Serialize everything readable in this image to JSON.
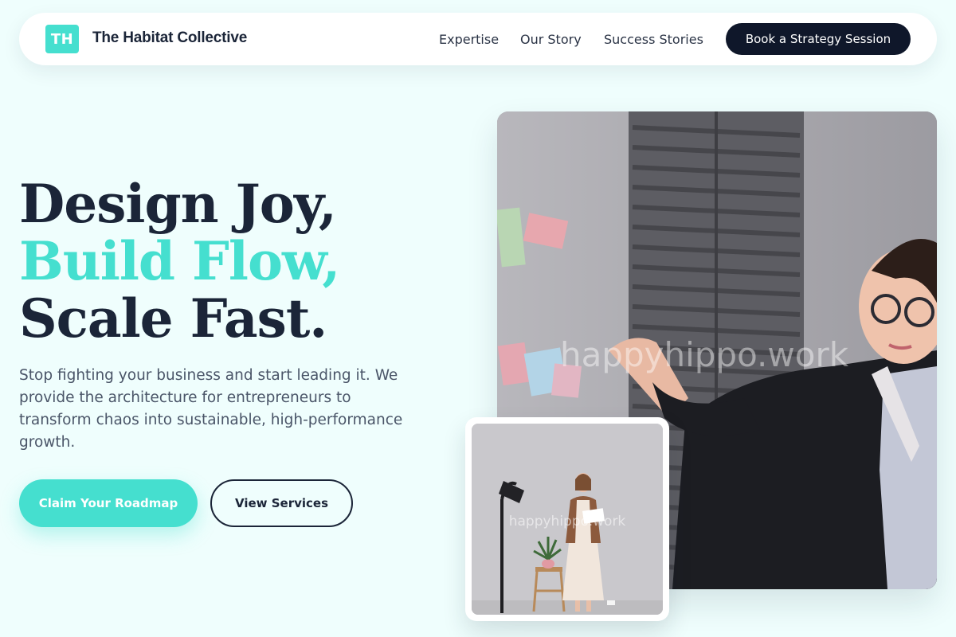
{
  "nav": {
    "logo_initials": "TH",
    "brand": "The Habitat Collective",
    "links": [
      "Expertise",
      "Our Story",
      "Success Stories"
    ],
    "cta": "Book a Strategy Session"
  },
  "hero": {
    "headline_line1": "Design Joy,",
    "headline_line2": "Build Flow,",
    "headline_line3": "Scale Fast.",
    "subtext": "Stop fighting your business and start leading it. We provide the architecture for entrepreneurs to transform chaos into sustainable, high-performance growth.",
    "primary_button": "Claim Your Roadmap",
    "secondary_button": "View Services"
  },
  "images": {
    "main_watermark": "happyhippo.work",
    "small_watermark": "happyhippo.work"
  },
  "colors": {
    "accent": "#45dfcf",
    "dark": "#0f172a",
    "background": "#effefd"
  }
}
